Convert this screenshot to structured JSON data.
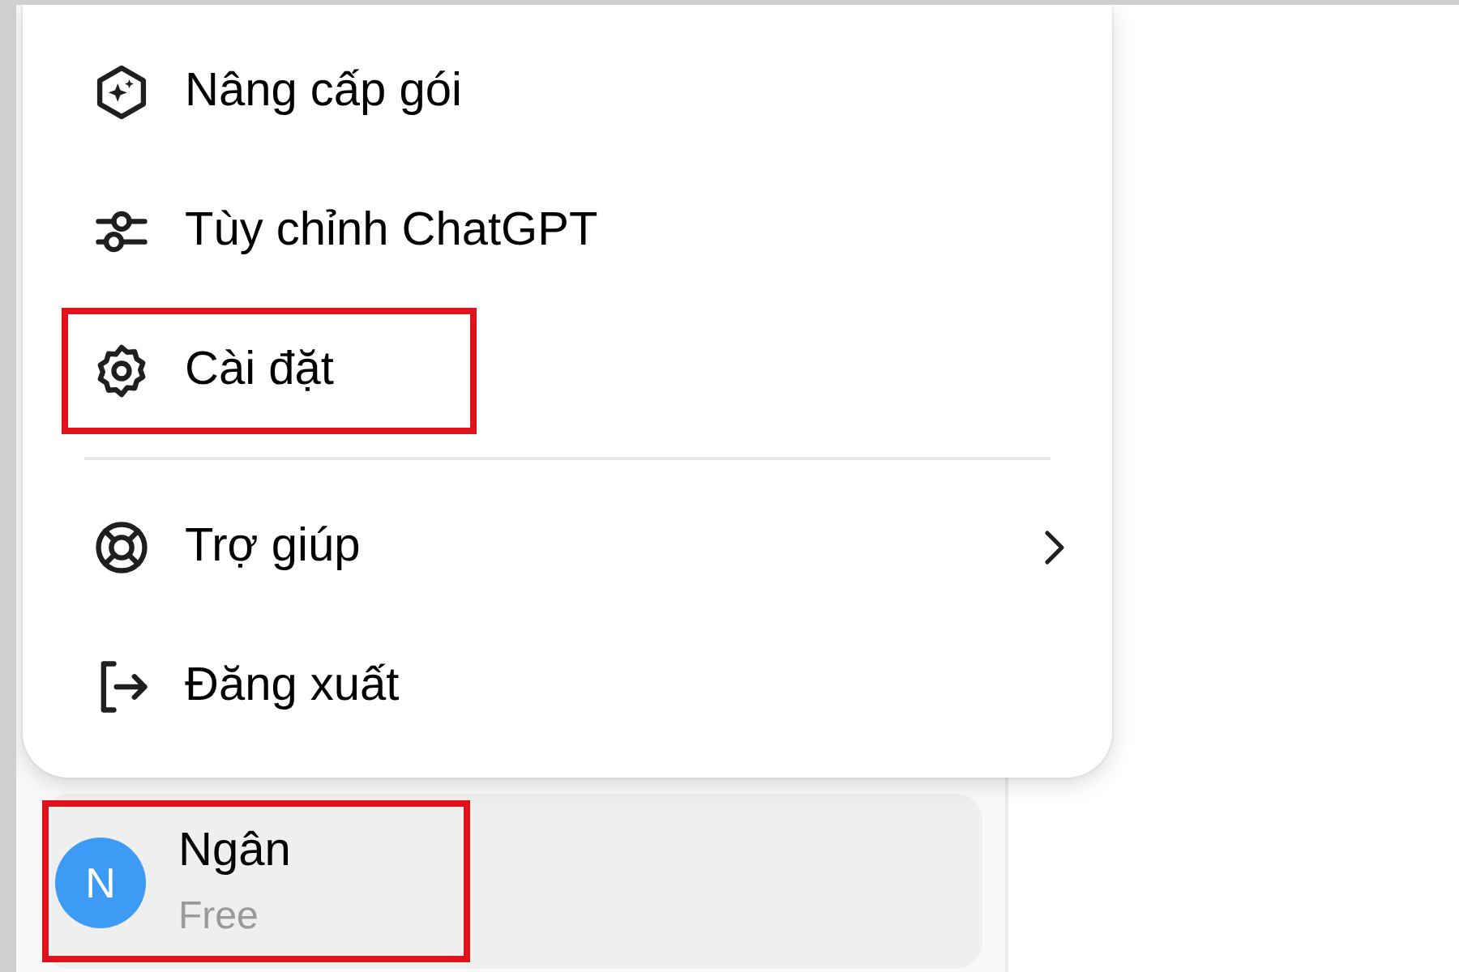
{
  "menu": {
    "items": [
      {
        "kind": "item",
        "label": "Nâng cấp gói",
        "highlighted": false,
        "submenu": false
      },
      {
        "kind": "item",
        "label": "Tùy chỉnh ChatGPT",
        "highlighted": false,
        "submenu": false
      },
      {
        "kind": "item",
        "label": "Cài đặt",
        "highlighted": true,
        "submenu": false
      },
      {
        "kind": "divider"
      },
      {
        "kind": "item",
        "label": "Trợ giúp",
        "highlighted": false,
        "submenu": true
      },
      {
        "kind": "item",
        "label": "Đăng xuất",
        "highlighted": false,
        "submenu": false
      }
    ]
  },
  "user": {
    "avatar_initial": "N",
    "name": "Ngân",
    "plan": "Free",
    "highlighted": true
  }
}
